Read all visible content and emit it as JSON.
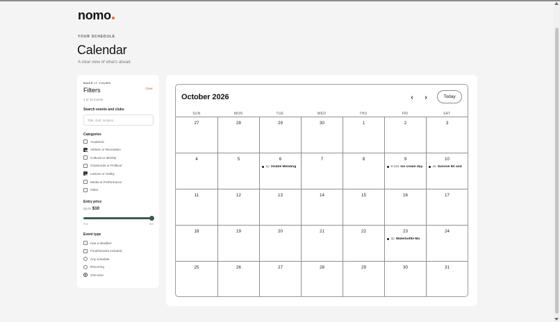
{
  "brand": {
    "name": "nomo",
    "accent": "#e56a2a"
  },
  "header": {
    "eyebrow": "YOUR SCHEDULE",
    "title": "Calendar",
    "subtitle": "A clear view of what's ahead."
  },
  "filters": {
    "eyebrow": "MAKE IT YOURS",
    "title": "Filters",
    "clear_label": "Clear",
    "count_text": "4 of 16 events",
    "search": {
      "label": "Search events and clubs",
      "placeholder": "Title, club, location…",
      "value": ""
    },
    "categories": {
      "label": "Categories",
      "items": [
        {
          "label": "Academic",
          "checked": false
        },
        {
          "label": "Athletic or Recreation",
          "checked": true
        },
        {
          "label": "Cultural or Identity",
          "checked": false
        },
        {
          "label": "Grassroots or Political",
          "checked": false
        },
        {
          "label": "Leisure or Hobby",
          "checked": true
        },
        {
          "label": "Media or Performance",
          "checked": false
        },
        {
          "label": "Other",
          "checked": false
        }
      ]
    },
    "price": {
      "label": "Entry price",
      "prefix": "Up to",
      "value_text": "$10",
      "value": 10,
      "min": 0,
      "max": 10,
      "min_label": "Free",
      "max_label": "$10",
      "accent": "#3f5a4a"
    },
    "event_type": {
      "label": "Event type",
      "checkboxes": [
        {
          "label": "Has a deadline",
          "checked": false
        },
        {
          "label": "Food/Snacks included",
          "checked": false
        }
      ],
      "radios": [
        {
          "label": "Any schedule",
          "selected": false
        },
        {
          "label": "Recurring",
          "selected": false
        },
        {
          "label": "One-time",
          "selected": true
        }
      ]
    }
  },
  "calendar": {
    "month_label": "October 2026",
    "prev_icon": "chevron-left-icon",
    "next_icon": "chevron-right-icon",
    "today_label": "Today",
    "weekdays": [
      "SUN",
      "MON",
      "TUE",
      "WED",
      "THU",
      "FRI",
      "SAT"
    ],
    "weeks": [
      [
        {
          "day": "27"
        },
        {
          "day": "28"
        },
        {
          "day": "29"
        },
        {
          "day": "30"
        },
        {
          "day": "1"
        },
        {
          "day": "2"
        },
        {
          "day": "3"
        }
      ],
      [
        {
          "day": "4"
        },
        {
          "day": "5"
        },
        {
          "day": "6",
          "event": {
            "time": "1p",
            "title": "Visible Mending"
          }
        },
        {
          "day": "7"
        },
        {
          "day": "8"
        },
        {
          "day": "9",
          "event": {
            "time": "9:23a",
            "title": "Ice cream day"
          }
        },
        {
          "day": "10",
          "event": {
            "time": "4a",
            "title": "Sunrise 5K and"
          }
        }
      ],
      [
        {
          "day": "11"
        },
        {
          "day": "12"
        },
        {
          "day": "13"
        },
        {
          "day": "14"
        },
        {
          "day": "15"
        },
        {
          "day": "16"
        },
        {
          "day": "17"
        }
      ],
      [
        {
          "day": "18"
        },
        {
          "day": "19"
        },
        {
          "day": "20"
        },
        {
          "day": "21"
        },
        {
          "day": "22"
        },
        {
          "day": "23",
          "event": {
            "time": "2p",
            "title": "Waterbottle Ma"
          }
        },
        {
          "day": "24"
        }
      ],
      [
        {
          "day": "25"
        },
        {
          "day": "26"
        },
        {
          "day": "27"
        },
        {
          "day": "28"
        },
        {
          "day": "29"
        },
        {
          "day": "30"
        },
        {
          "day": "31"
        }
      ]
    ]
  }
}
